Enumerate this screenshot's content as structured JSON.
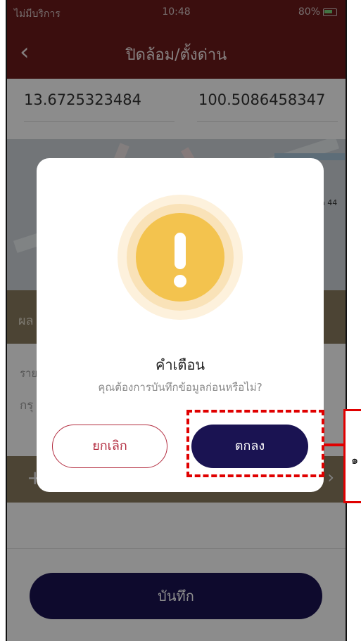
{
  "status_bar": {
    "carrier": "ไม่มีบริการ",
    "time": "10:48",
    "battery": "80%"
  },
  "header": {
    "back_icon": "chevron-left-icon",
    "title": "ปิดล้อม/ตั้งด่าน"
  },
  "location": {
    "latitude": "13.6725323484",
    "longitude": "100.5086458347"
  },
  "map": {
    "label": "a 44"
  },
  "section": {
    "band_label": "ผล",
    "field_label": "ราย",
    "field_placeholder": "กรุ",
    "band2_plus": "+",
    "band2_chevron": "›"
  },
  "save_button": "บันทึก",
  "dialog": {
    "icon": "warning-icon",
    "title": "คำเตือน",
    "message": "คุณต้องการบันทึกข้อมูลก่อนหรือไม่?",
    "cancel_label": "ยกเลิก",
    "confirm_label": "ตกลง"
  },
  "annotation": {
    "number": "๑"
  },
  "colors": {
    "header": "#6c1a1a",
    "primary_button": "#1a1352",
    "warning": "#f3c34e",
    "cancel_border": "#b32d40",
    "annotation": "#e00000"
  }
}
